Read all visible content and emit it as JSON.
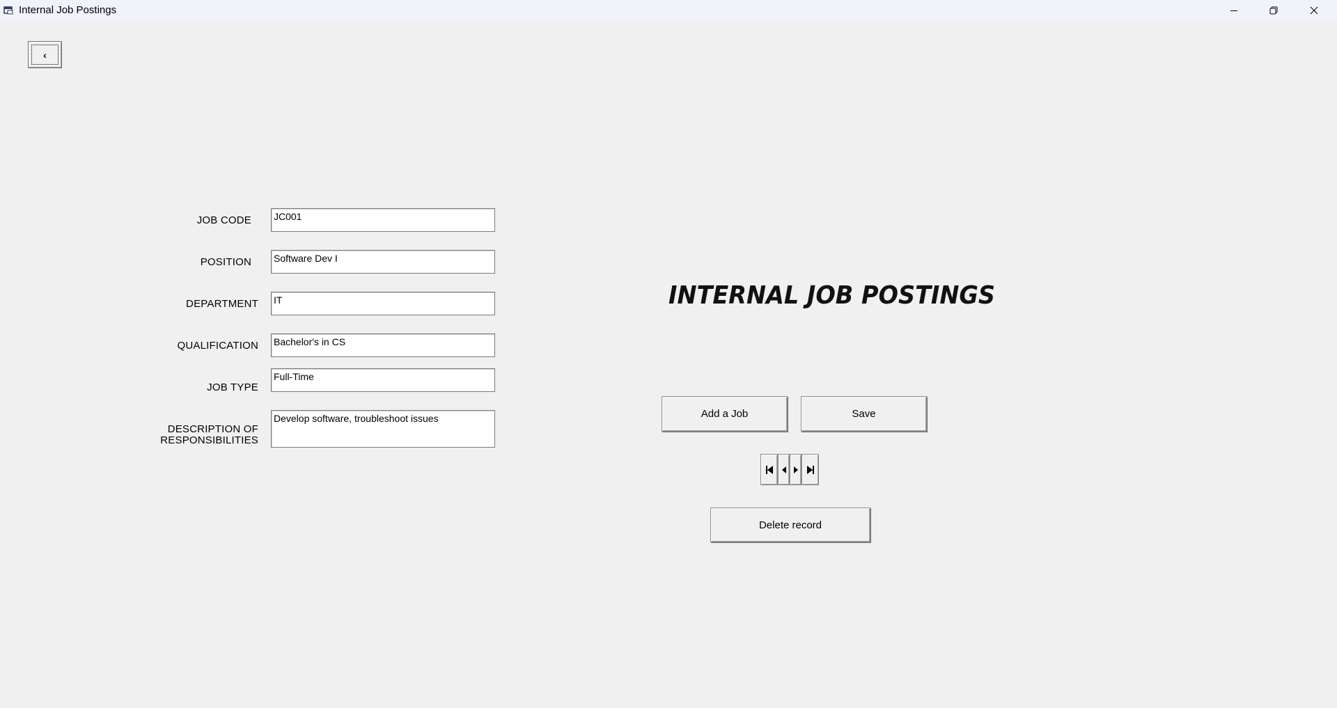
{
  "window": {
    "title": "Internal Job Postings"
  },
  "heading": "INTERNAL JOB POSTINGS",
  "back_button": {
    "label": "‹"
  },
  "form": {
    "job_code": {
      "label": "JOB CODE",
      "value": "JC001"
    },
    "position": {
      "label": "POSITION",
      "value": "Software Dev I"
    },
    "department": {
      "label": "DEPARTMENT",
      "value": "IT"
    },
    "qualification": {
      "label": "QUALIFICATION",
      "value": "Bachelor's in CS"
    },
    "job_type": {
      "label": "JOB TYPE",
      "value": "Full-Time"
    },
    "description": {
      "label_line1": "DESCRIPTION OF",
      "label_line2": "RESPONSIBILITIES",
      "value": "Develop software, troubleshoot issues"
    }
  },
  "buttons": {
    "add_job": "Add a Job",
    "save": "Save",
    "delete": "Delete record"
  },
  "icons": {
    "first": "first-record-icon",
    "prev": "previous-record-icon",
    "next": "next-record-icon",
    "last": "last-record-icon"
  }
}
